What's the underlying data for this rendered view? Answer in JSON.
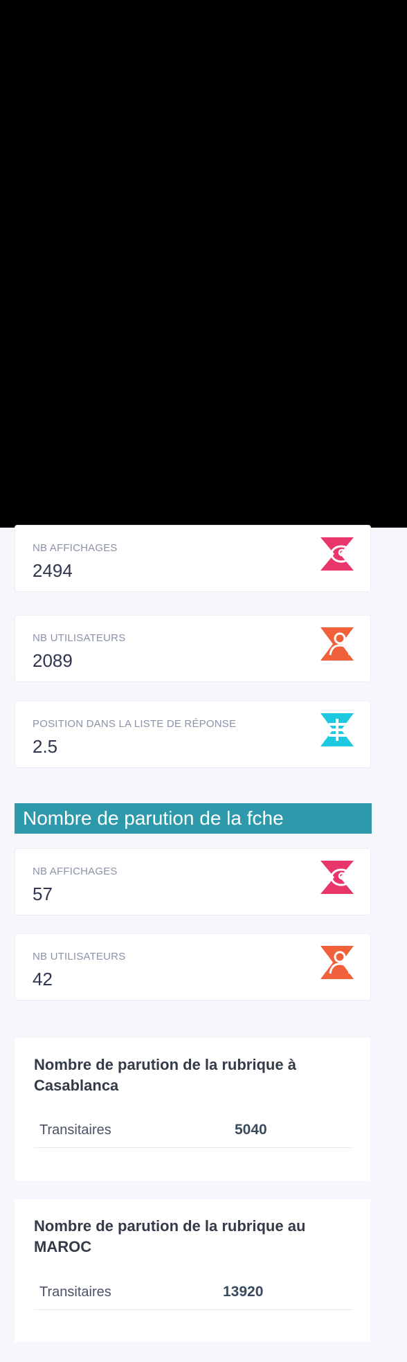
{
  "stats_top": [
    {
      "label": "NB AFFICHAGES",
      "value": "2494",
      "icon": "eye-icon",
      "color": "#e8366a"
    },
    {
      "label": "NB UTILISATEURS",
      "value": "2089",
      "icon": "users-icon",
      "color": "#f0603a"
    },
    {
      "label": "POSITION DANS LA LISTE DE RÉPONSE",
      "value": "2.5",
      "icon": "list-icon",
      "color": "#1ec8e0"
    }
  ],
  "section": {
    "title": "Nombre de parution de la f​che"
  },
  "stats_bottom": [
    {
      "label": "NB AFFICHAGES",
      "value": "57",
      "icon": "eye-icon",
      "color": "#e8366a"
    },
    {
      "label": "NB UTILISATEURS",
      "value": "42",
      "icon": "users-icon",
      "color": "#f0603a"
    }
  ],
  "panels": [
    {
      "title": "Nombre de parution de la rubrique à Casablanca",
      "row_name": "Transitaires",
      "row_value": "5040"
    },
    {
      "title": "Nombre de parution de la rubrique au MAROC",
      "row_name": "Transitaires",
      "row_value": "13920"
    }
  ]
}
